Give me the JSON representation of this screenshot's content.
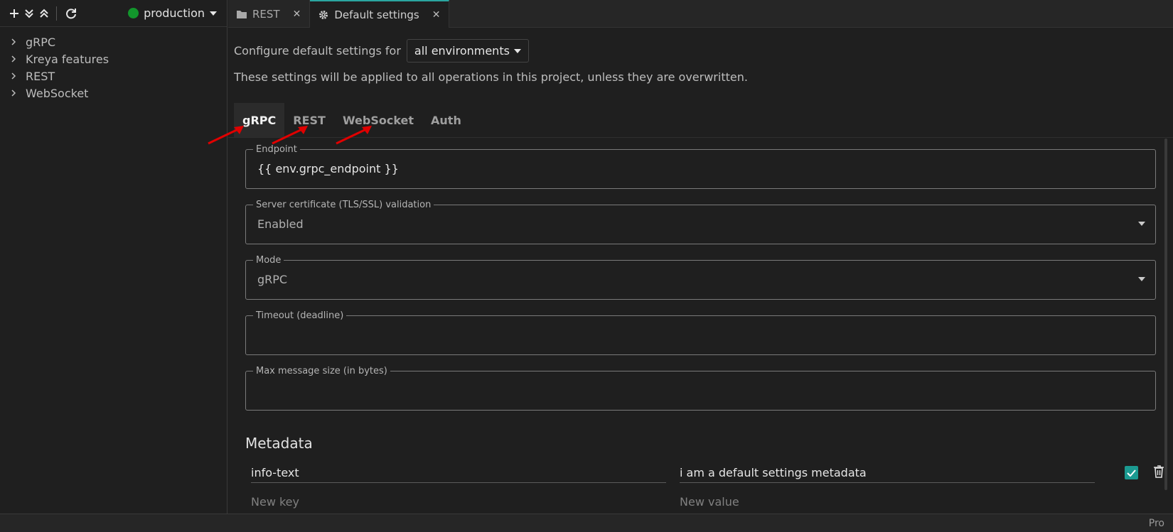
{
  "sidebar": {
    "environment": {
      "name": "production",
      "status_color": "#12962c"
    },
    "toolbar_icons": [
      "plus-icon",
      "expand-all-icon",
      "collapse-all-icon",
      "refresh-icon"
    ],
    "items": [
      {
        "label": "gRPC"
      },
      {
        "label": "Kreya features"
      },
      {
        "label": "REST"
      },
      {
        "label": "WebSocket"
      }
    ]
  },
  "tabs": [
    {
      "label": "REST",
      "icon": "folder-icon",
      "active": false
    },
    {
      "label": "Default settings",
      "icon": "gear-icon",
      "active": true
    }
  ],
  "main": {
    "configure_label": "Configure default settings for",
    "environment_select": "all environments",
    "description": "These settings will be applied to all operations in this project, unless they are overwritten.",
    "settings_tabs": [
      {
        "label": "gRPC",
        "active": true
      },
      {
        "label": "REST",
        "active": false
      },
      {
        "label": "WebSocket",
        "active": false
      },
      {
        "label": "Auth",
        "active": false
      }
    ],
    "fields": {
      "endpoint": {
        "label": "Endpoint",
        "value": "{{ env.grpc_endpoint }}"
      },
      "tls": {
        "label": "Server certificate (TLS/SSL) validation",
        "value": "Enabled"
      },
      "mode": {
        "label": "Mode",
        "value": "gRPC"
      },
      "timeout": {
        "label": "Timeout (deadline)",
        "value": ""
      },
      "max_message": {
        "label": "Max message size (in bytes)",
        "value": ""
      }
    },
    "metadata": {
      "title": "Metadata",
      "rows": [
        {
          "key": "info-text",
          "value": "i am a default settings metadata",
          "enabled": true
        }
      ],
      "new_key_placeholder": "New key",
      "new_value_placeholder": "New value"
    }
  },
  "statusbar": {
    "text": "Pro"
  },
  "colors": {
    "accent": "#1b9a91",
    "annotation_arrow": "#e00000"
  }
}
